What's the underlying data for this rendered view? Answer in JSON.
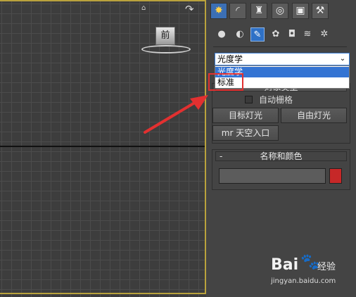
{
  "viewport": {
    "viewcube_label": "前",
    "home_icon": "⌂",
    "orbit_icon": "↷",
    "border_color": "#b9a23c"
  },
  "panel": {
    "tabs": [
      {
        "icon": "create-icon",
        "glyph": "✸"
      },
      {
        "icon": "modify-icon",
        "glyph": "◜"
      },
      {
        "icon": "hierarchy-icon",
        "glyph": "♜"
      },
      {
        "icon": "motion-icon",
        "glyph": "◎"
      },
      {
        "icon": "display-icon",
        "glyph": "▣"
      },
      {
        "icon": "utilities-icon",
        "glyph": "⚒"
      }
    ],
    "categories": [
      {
        "icon": "geometry-icon",
        "glyph": "●"
      },
      {
        "icon": "shapes-icon",
        "glyph": "◐"
      },
      {
        "icon": "lights-icon",
        "glyph": "✎"
      },
      {
        "icon": "cameras-icon",
        "glyph": "✿"
      },
      {
        "icon": "helpers-icon",
        "glyph": "◘"
      },
      {
        "icon": "spacewarps-icon",
        "glyph": "≋"
      },
      {
        "icon": "systems-icon",
        "glyph": "✲"
      }
    ],
    "dropdown": {
      "selected": "光度学",
      "arrow": "⌄",
      "options": [
        "光度学",
        "标准"
      ]
    },
    "object_type": {
      "header": "对象类型",
      "autogrid_label": "自动栅格",
      "buttons": [
        "目标灯光",
        "自由灯光",
        "mr 天空入口"
      ]
    },
    "name_color": {
      "collapse": "-",
      "header": "名称和颜色",
      "name_value": "",
      "swatch_color": "#c62828"
    }
  },
  "annotation": {
    "highlight_color": "#e23030"
  },
  "watermark": {
    "brand": "Bai",
    "paw": "🐾",
    "jingyan": "经验",
    "url": "jingyan.baidu.com"
  }
}
